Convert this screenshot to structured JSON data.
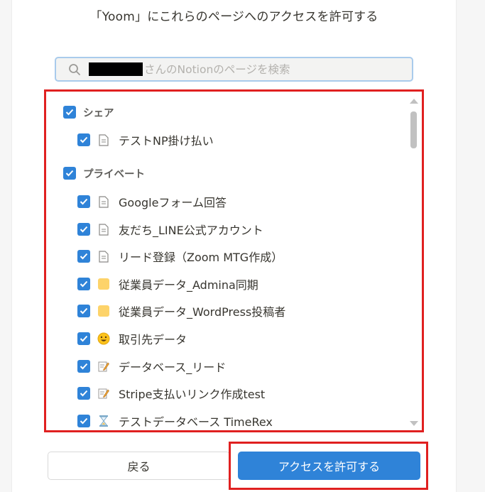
{
  "header": {
    "title": "「Yoom」にこれらのページへのアクセスを許可する"
  },
  "search": {
    "placeholder": "さんのNotionのページを検索"
  },
  "sections": [
    {
      "label": "シェア",
      "checked": true,
      "items": [
        {
          "label": "テストNP掛け払い",
          "icon": "page-icon",
          "checked": true
        }
      ]
    },
    {
      "label": "プライベート",
      "checked": true,
      "items": [
        {
          "label": "Googleフォーム回答",
          "icon": "page-icon",
          "checked": true
        },
        {
          "label": "友だち_LINE公式アカウント",
          "icon": "page-icon",
          "checked": true
        },
        {
          "label": "リード登録（Zoom MTG作成）",
          "icon": "page-icon",
          "checked": true
        },
        {
          "label": "従業員データ_Admina同期",
          "icon": "yellow-square-icon",
          "checked": true
        },
        {
          "label": "従業員データ_WordPress投稿者",
          "icon": "yellow-square-icon",
          "checked": true
        },
        {
          "label": "取引先データ",
          "icon": "smiley-icon",
          "checked": true
        },
        {
          "label": "データベース_リード",
          "icon": "memo-icon",
          "checked": true
        },
        {
          "label": "Stripe支払いリンク作成test",
          "icon": "memo-icon",
          "checked": true
        },
        {
          "label": "テストデータベース TimeRex",
          "icon": "hourglass-icon",
          "checked": true
        }
      ]
    }
  ],
  "buttons": {
    "back": "戻る",
    "allow": "アクセスを許可する"
  },
  "colors": {
    "accent": "#2f83d8",
    "highlight": "#e02020",
    "folder": "#fdd36a"
  }
}
